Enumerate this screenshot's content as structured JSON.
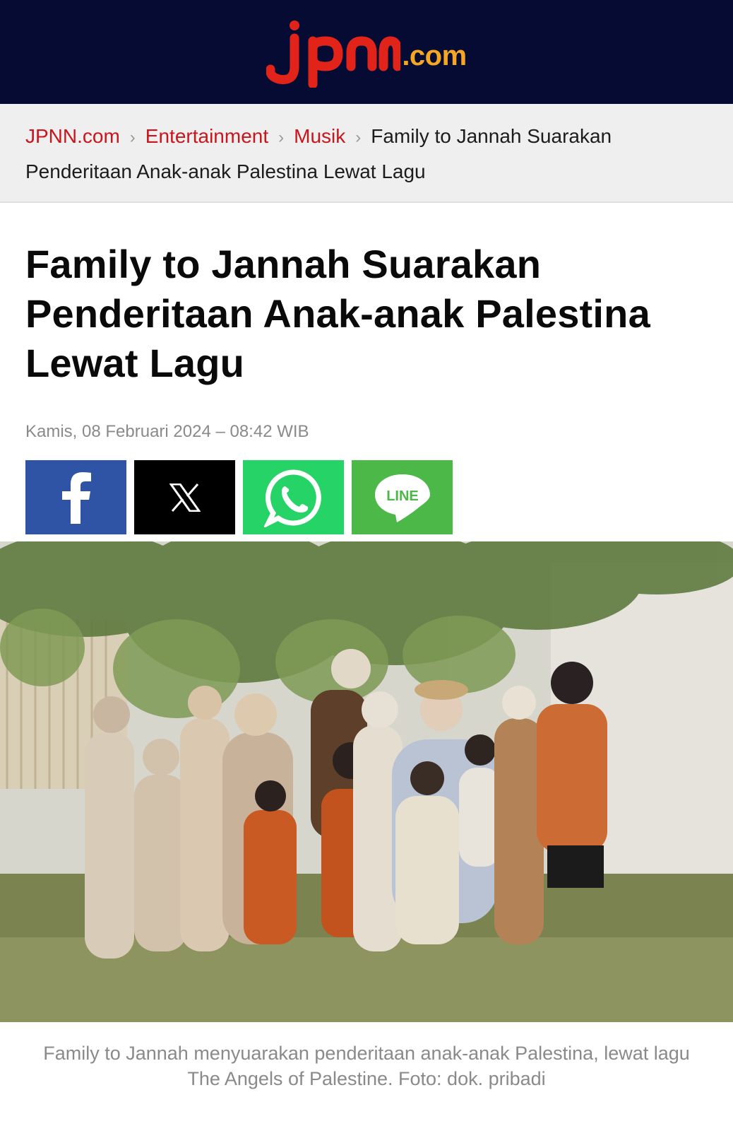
{
  "site": {
    "logo_text": "jpnn",
    "logo_suffix": ".com",
    "logo_color": "#e2231a",
    "header_bg": "#050b33"
  },
  "breadcrumb": {
    "items": [
      {
        "label": "JPNN.com"
      },
      {
        "label": "Entertainment"
      },
      {
        "label": "Musik"
      }
    ],
    "current": "Family to Jannah Suarakan Penderitaan Anak-anak Palestina Lewat Lagu",
    "link_color": "#c8161d"
  },
  "article": {
    "title": "Family to Jannah Suarakan Penderitaan Anak-anak Palestina Lewat Lagu",
    "date": "Kamis, 08 Februari 2024 – 08:42 WIB",
    "caption": "Family to Jannah menyuarakan penderitaan anak-anak Palestina, lewat lagu The Angels of Palestine. Foto: dok. pribadi"
  },
  "share": [
    {
      "name": "facebook",
      "icon": "facebook-icon",
      "color": "#3b5998"
    },
    {
      "name": "x",
      "icon": "x-icon",
      "color": "#000000"
    },
    {
      "name": "whatsapp",
      "icon": "whatsapp-icon",
      "color": "#25d366"
    },
    {
      "name": "line",
      "icon": "line-icon",
      "color": "#4cb848",
      "label": "LINE"
    }
  ]
}
